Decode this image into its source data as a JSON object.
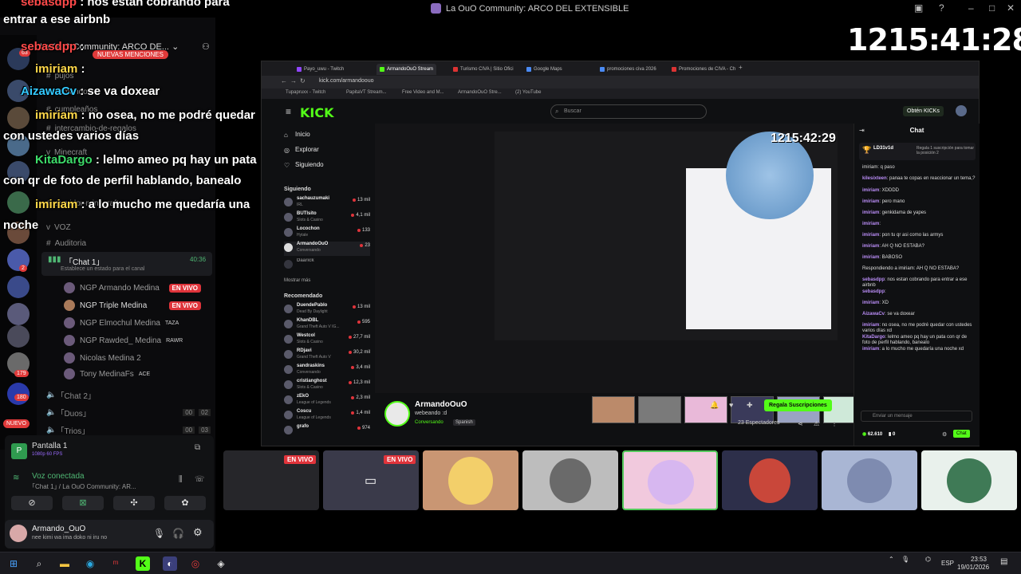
{
  "window": {
    "title": "La OuO Community: ARCO DEL EXTENSIBLE"
  },
  "timer_main": "1215:41:28",
  "timer_inner": "1215:42:29",
  "overlay_chat": [
    {
      "name": "sebasdpp",
      "text": ": nos estan cobrando para",
      "color": "#ff4a4a"
    },
    {
      "name": "",
      "text": "entrar a ese airbnb",
      "color": "#ffffff"
    },
    {
      "name": "sebasdpp",
      "text": ":",
      "color": "#ff4a4a"
    },
    {
      "name": "imiriam",
      "text": ":",
      "color": "#ffd84a"
    },
    {
      "name": "AizawaCv",
      "text": ": se va doxear",
      "color": "#33c9ff"
    },
    {
      "name": "imiriam",
      "text": ": no osea, no me podré quedar",
      "color": "#ffd84a"
    },
    {
      "name": "",
      "text": "con ustedes varios días",
      "color": "#ffffff"
    },
    {
      "name": "KitaDargo",
      "text": ": lelmo ameo pq hay un pata",
      "color": "#3ddc6a"
    },
    {
      "name": "",
      "text": "con qr de foto de perfil hablando, banealo",
      "color": "#ffffff"
    },
    {
      "name": "imiriam",
      "text": ": a lo mucho me quedaría una",
      "color": "#ffd84a"
    },
    {
      "name": "",
      "text": "noche",
      "color": "#ffffff"
    }
  ],
  "discord": {
    "server_name": "La OuO Community: ARCO DE...",
    "mentions_badge": "NUEVAS MENCIONES",
    "channels": [
      {
        "label": "pujos",
        "icon": "#"
      },
      {
        "label": "comandos",
        "icon": "#"
      },
      {
        "label": "cumpleaños",
        "icon": "#"
      },
      {
        "label": "intercambio-de-regalos",
        "icon": "#"
      },
      {
        "label": "Minecraft",
        "icon": "v"
      },
      {
        "label": "servidor-minecraft",
        "icon": "#"
      },
      {
        "label": "VOZ",
        "icon": "v"
      },
      {
        "label": "Auditoria",
        "icon": "#"
      }
    ],
    "voice_channel": {
      "name": "｢Chat 1｣",
      "time": "40:36",
      "status": "Establece un estado para el canal"
    },
    "voice_users": [
      {
        "name": "NGP Armando Medina",
        "live": "EN VIVO"
      },
      {
        "name": "NGP Triple Medina",
        "live": "EN VIVO"
      },
      {
        "name": "NGP Elmochul Medina",
        "tag": "TAZA"
      },
      {
        "name": "NGP Rawded_ Medina",
        "tag": "RAWR"
      },
      {
        "name": "Nicolas Medina 2",
        "tag": ""
      },
      {
        "name": "Tony MedinaFs",
        "tag": "ACE"
      }
    ],
    "other_channels": [
      {
        "name": "｢Chat 2｣"
      },
      {
        "name": "｢Duos｣",
        "c1": "00",
        "c2": "02"
      },
      {
        "name": "｢Trios｣",
        "c1": "00",
        "c2": "03"
      }
    ],
    "server_badges": [
      "63",
      "2",
      "179",
      "180"
    ],
    "new_label": "NUEVO",
    "screen_share": {
      "title": "Pantalla 1",
      "sub": "1080p 60 FPS"
    },
    "voice_connected": {
      "title": "Voz conectada",
      "sub": "｢Chat 1｣ / La OuO Community: AR..."
    },
    "user": {
      "name": "Armando_OuO",
      "status": "nee kimi wa ima doko ni iru no"
    }
  },
  "browser": {
    "tabs": [
      {
        "label": "Payo_uwu - Twitch"
      },
      {
        "label": "ArmandoOuO Stream",
        "active": true
      },
      {
        "label": "Turismo CIVA | Sitio Ofici"
      },
      {
        "label": "Google Maps"
      },
      {
        "label": "promociones civa 2026"
      },
      {
        "label": "Promociones de CIVA - Ch"
      }
    ],
    "url": "kick.com/armandoouo",
    "bookmarks": [
      "Tupapruxx - Twitch",
      "PapitaVT Stream...",
      "Free Video and M...",
      "ArmandoOuO Stre...",
      "(2) YouTube"
    ]
  },
  "kick": {
    "logo": "KICK",
    "search_placeholder": "Buscar",
    "kicks_button": "Obtén KICKs",
    "nav": [
      {
        "label": "Inicio",
        "icon": "⌂"
      },
      {
        "label": "Explorar",
        "icon": "◎"
      },
      {
        "label": "Siguiendo",
        "icon": "♡"
      }
    ],
    "following_title": "Siguiendo",
    "following": [
      {
        "name": "sachauzumaki",
        "cat": "IRL",
        "viewers": "13 mil"
      },
      {
        "name": "BUTIsito",
        "cat": "Slots & Casino",
        "viewers": "4,1 mil"
      },
      {
        "name": "Locochon",
        "cat": "Hytale",
        "viewers": "133"
      },
      {
        "name": "ArmandoOuO",
        "cat": "Conversando",
        "viewers": "23"
      },
      {
        "name": "Daarick",
        "cat": "",
        "viewers": ""
      }
    ],
    "show_more": "Mostrar más",
    "recommended_title": "Recomendado",
    "recommended": [
      {
        "name": "DuendePablo",
        "cat": "Dead By Daylight",
        "viewers": "13 mil"
      },
      {
        "name": "KhanDBL",
        "cat": "Grand Theft Auto V IG...",
        "viewers": "595"
      },
      {
        "name": "Westcol",
        "cat": "Slots & Casino",
        "viewers": "27,7 mil"
      },
      {
        "name": "RDjavi",
        "cat": "Grand Theft Auto V",
        "viewers": "30,2 mil"
      },
      {
        "name": "sandraskins",
        "cat": "Conversando",
        "viewers": "3,4 mil"
      },
      {
        "name": "cristianghost",
        "cat": "Slots & Casino",
        "viewers": "12,3 mil"
      },
      {
        "name": "zEkO",
        "cat": "League of Legends",
        "viewers": "2,3 mil"
      },
      {
        "name": "Coscu",
        "cat": "League of Legends",
        "viewers": "1,4 mil"
      },
      {
        "name": "grafo",
        "cat": "",
        "viewers": "974"
      }
    ],
    "streamer": {
      "name": "ArmandoOuO",
      "title": "webeando :d",
      "category": "Conversando",
      "language": "Spanish",
      "viewers": "23 Espectadores",
      "sub_button": "Regala Suscripciones"
    },
    "chat": {
      "title": "Chat",
      "top_gifter": "LD31v1d",
      "top_gifter_note": "Regala 1 suscripción para tomar la posición 2",
      "messages": [
        {
          "user": "",
          "text": "imiriam: q paso"
        },
        {
          "user": "kilesixteen",
          "text": ": panaa te copas en reaccionar un tema,?"
        },
        {
          "user": "imiriam",
          "text": ": XDDDD"
        },
        {
          "user": "imiriam",
          "text": ": pero mano"
        },
        {
          "user": "imiriam",
          "text": ": genkidama de yapes"
        },
        {
          "user": "imiriam",
          "text": ":"
        },
        {
          "user": "imiriam",
          "text": ": pon tu qr asi como las armys"
        },
        {
          "user": "imiriam",
          "text": ": AH Q NO ESTABA?"
        },
        {
          "user": "imiriam",
          "text": ": BABOSO"
        },
        {
          "user": "",
          "text": "Respondiendo a imiriam: AH Q NO ESTABA?"
        },
        {
          "user": "sebasdpp",
          "text": ": nos estan cobrando para entrar a ese airbnb"
        },
        {
          "user": "sebasdpp",
          "text": ":"
        },
        {
          "user": "imiriam",
          "text": ": XD"
        },
        {
          "user": "AizawaCv",
          "text": ": se va doxear"
        },
        {
          "user": "imiriam",
          "text": ": no osea, no me podré quedar con ustedes varios días xd"
        },
        {
          "user": "KitaDargo",
          "text": ": lelmo ameo pq hay un pata con qr de foto de perfil hablando, banealo"
        },
        {
          "user": "imiriam",
          "text": ": a lo mucho me quedaría una noche xd"
        }
      ],
      "input_placeholder": "Enviar un mensaje",
      "points": "62.610",
      "kicks": "0",
      "send_label": "Chat"
    }
  },
  "stage": {
    "live_label": "EN VIVO"
  },
  "taskbar": {
    "lang": "ESP",
    "time": "23:53",
    "date": "19/01/2026"
  }
}
